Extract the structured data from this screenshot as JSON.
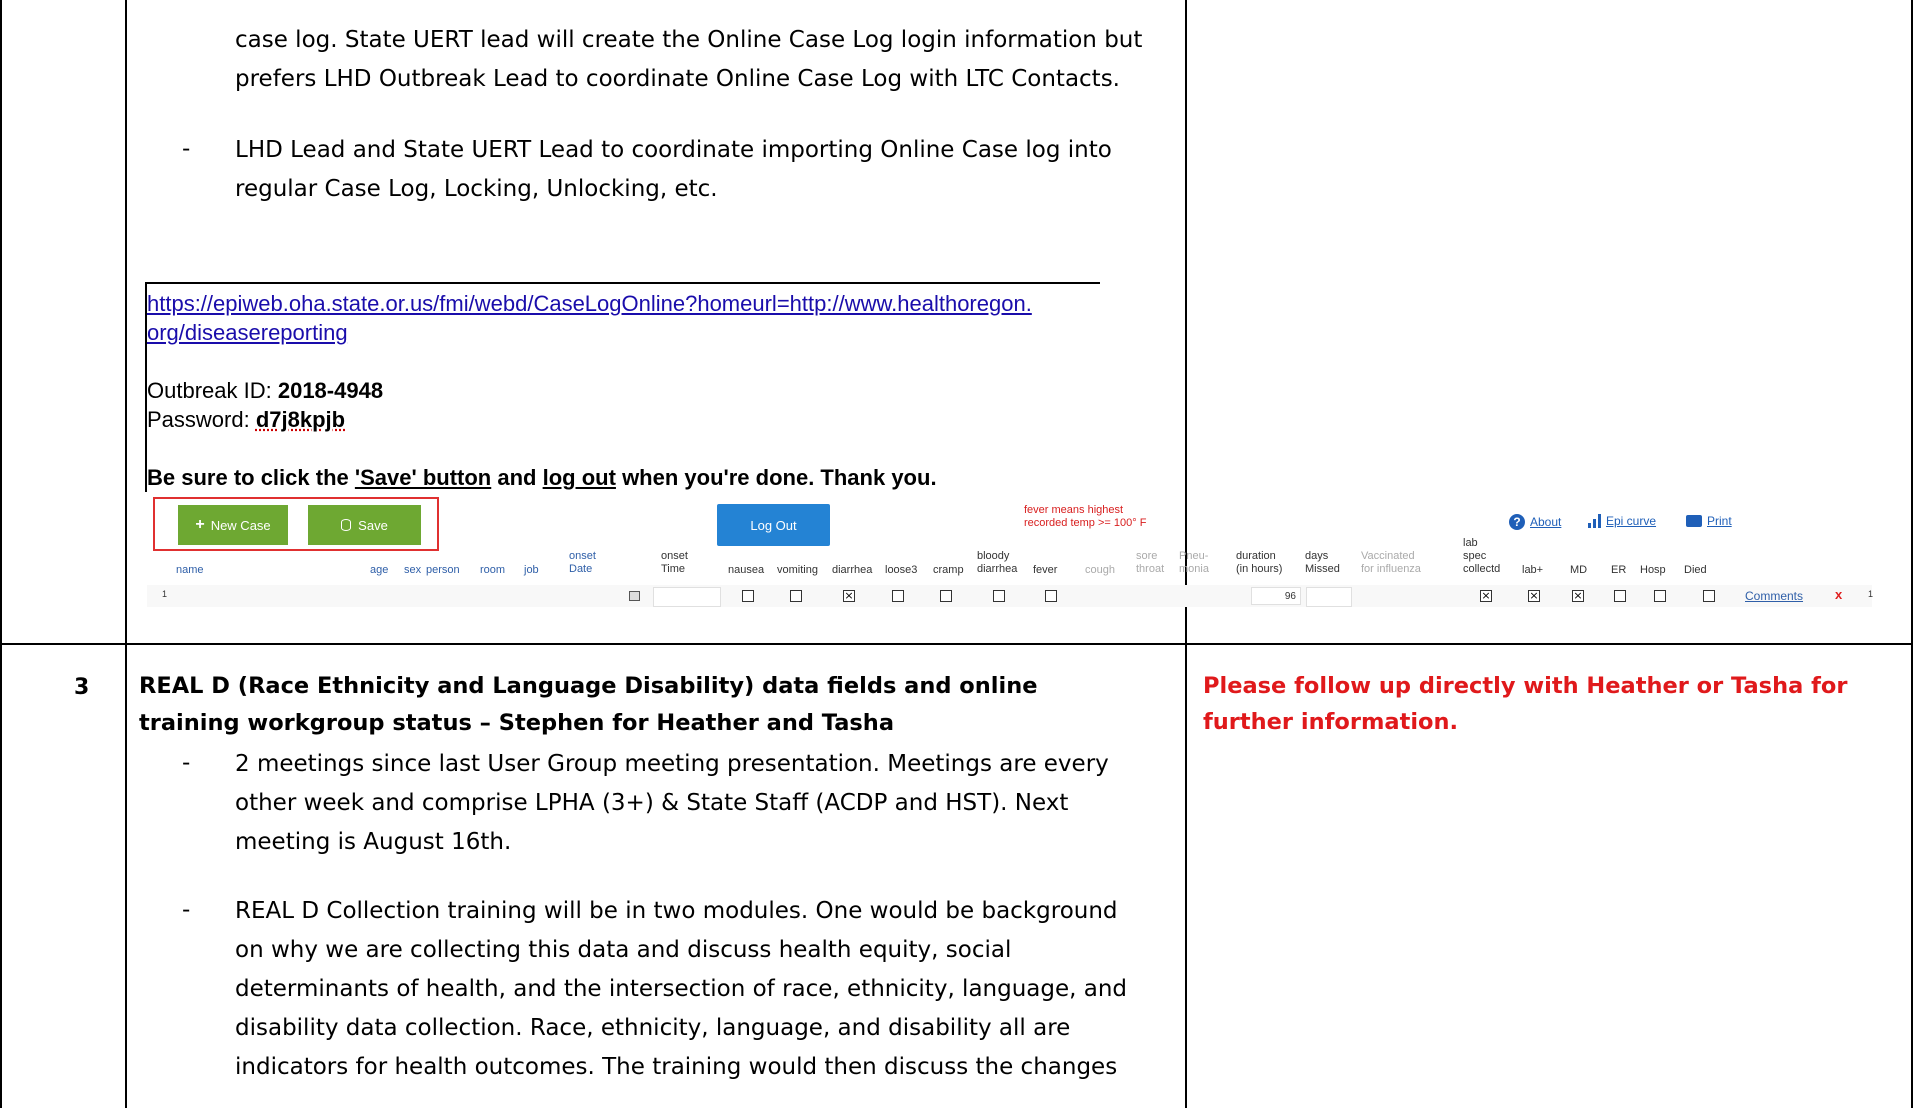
{
  "row_top": {
    "para1": [
      "case log. State UERT lead will create the Online Case Log login information but",
      "prefers LHD Outbreak Lead to coordinate Online Case Log with LTC Contacts."
    ],
    "bullet_dash": "-",
    "bullet2": [
      "LHD Lead and State UERT Lead to coordinate importing Online Case log into",
      "regular Case Log, Locking, Unlocking, etc."
    ]
  },
  "email": {
    "link_line1": "https://epiweb.oha.state.or.us/fmi/webd/CaseLogOnline?homeurl=http://www.healthoregon.",
    "link_line2": "org/diseasereporting",
    "outbreak_label": "Outbreak ID:",
    "outbreak_id": "2018-4948",
    "password_label": "Password:",
    "password": "d7j8kpjb",
    "closing_a": "Be sure to click the",
    "closing_save": "'Save' button",
    "closing_and": "and",
    "closing_logout": "log out",
    "closing_b": "when you're done. Thank you."
  },
  "caselog": {
    "new_case_label": "New Case",
    "save_label": "Save",
    "logout_label": "Log Out",
    "fever_note_1": "fever means highest",
    "fever_note_2": "recorded temp >= 100° F",
    "about_label": "About",
    "epi_label": "Epi curve",
    "print_label": "Print",
    "headers": {
      "name": "name",
      "age": "age",
      "sex": "sex",
      "person": "person",
      "room": "room",
      "job": "job",
      "onset1": "onset",
      "onset2": "Date",
      "onsettime1": "onset",
      "onsettime2": "Time",
      "nausea": "nausea",
      "vomiting": "vomiting",
      "diarrhea": "diarrhea",
      "loose3": "loose3",
      "cramp": "cramp",
      "bloody1": "bloody",
      "bloody2": "diarrhea",
      "fever": "fever",
      "cough": "cough",
      "sore1": "sore",
      "sore2": "throat",
      "pneu1": "Pneu-",
      "pneu2": "monia",
      "duration1": "duration",
      "duration2": "(in hours)",
      "days1": "days",
      "days2": "Missed",
      "vacc1": "Vaccinated",
      "vacc2": "for influenza",
      "lab1": "lab",
      "lab2": "spec",
      "lab3": "collectd",
      "labplus": "lab+",
      "md": "MD",
      "er": "ER",
      "hosp": "Hosp",
      "died": "Died"
    },
    "row": {
      "index": "1",
      "duration_value": "96",
      "comments_label": "Comments",
      "delete_label": "x",
      "trailing_index": "1"
    }
  },
  "row3": {
    "number": "3",
    "title_line1": "REAL D (Race Ethnicity and Language Disability) data fields and online",
    "title_line2": "training workgroup status – Stephen for Heather and Tasha",
    "bullet1": [
      "2 meetings since last User Group meeting presentation. Meetings are every",
      "other week and comprise LPHA (3+) & State Staff (ACDP and HST). Next",
      "meeting is August 16th."
    ],
    "bullet2": [
      "REAL D Collection training will be in two modules. One would be background",
      "on why we are collecting this data and discuss health equity, social",
      "determinants of health, and the intersection of race, ethnicity, language, and",
      "disability data collection. Race, ethnicity, language, and disability all are",
      "indicators for health outcomes. The training would then discuss the changes"
    ],
    "followup_line1": "Please follow up directly with Heather or Tasha for",
    "followup_line2": "further information.",
    "followup_color": "#e0191b"
  }
}
